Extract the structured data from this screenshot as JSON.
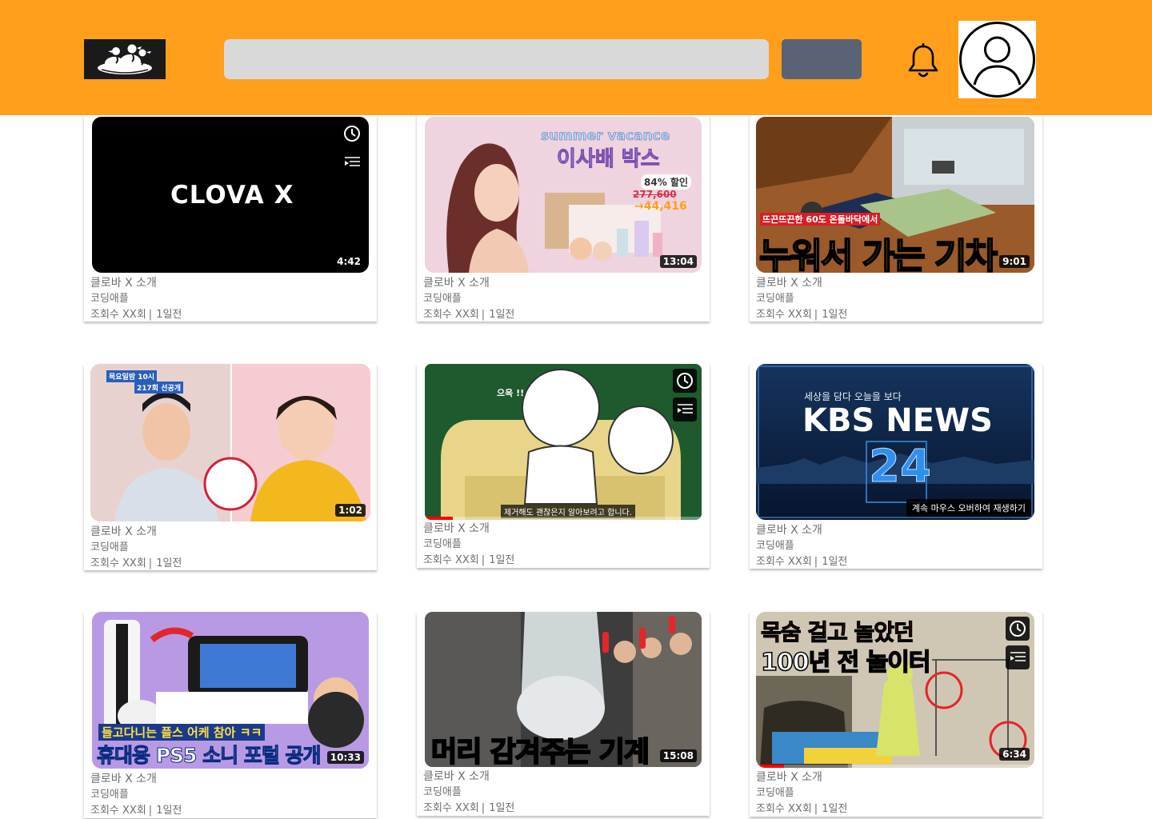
{
  "header": {
    "search_placeholder": "",
    "search_button_label": ""
  },
  "colors": {
    "header_bg": "#ff9f1c",
    "search_bg": "#d9d9d9",
    "search_button_bg": "#5a6276",
    "progress": "#ff0000"
  },
  "videos": [
    {
      "title": "클로바 X 소개",
      "channel": "코딩애플",
      "views": "조회수 XX회",
      "age": "1일전",
      "duration": "4:42",
      "thumb_text": "CLOVA X",
      "icons": [
        "watch-later-icon",
        "add-to-queue-icon"
      ]
    },
    {
      "title": "클로바 X 소개",
      "channel": "코딩애플",
      "views": "조회수 XX회",
      "age": "1일전",
      "duration": "13:04",
      "thumb_text": "summer vacance",
      "thumb_text2": "이사배 박스",
      "thumb_text3": "84% 할인",
      "thumb_text4": "277,600",
      "thumb_text5": "→44,416"
    },
    {
      "title": "클로바 X 소개",
      "channel": "코딩애플",
      "views": "조회수 XX회",
      "age": "1일전",
      "duration": "9:01",
      "thumb_text": "뜨끈뜨끈한 60도 온돌바닥에서",
      "thumb_text2": "누워서 가는 기차"
    },
    {
      "title": "클로바 X 소개",
      "channel": "코딩애플",
      "views": "조회수 XX회",
      "age": "1일전",
      "duration": "1:02",
      "thumb_text": "목요일밤 10시",
      "thumb_text2": "217회 선공개"
    },
    {
      "title": "클로바 X 소개",
      "channel": "코딩애플",
      "views": "조회수 XX회",
      "age": "1일전",
      "duration": "",
      "thumb_text": "으윽 !!",
      "thumb_text2": "제거해도 괜찮은지 알아보려고 합니다.",
      "icons": [
        "watch-later-icon",
        "add-to-queue-icon"
      ],
      "progress": 0.1
    },
    {
      "title": "클로바 X 소개",
      "channel": "코딩애플",
      "views": "조회수 XX회",
      "age": "1일전",
      "duration": "",
      "thumb_text": "세상을 담다 오늘을 보다",
      "thumb_text2": "KBS NEWS",
      "thumb_text3": "24",
      "hover_tip": "계속 마우스 오버하여 재생하기"
    },
    {
      "title": "클로바 X 소개",
      "channel": "코딩애플",
      "views": "조회수 XX회",
      "age": "1일전",
      "duration": "10:33",
      "thumb_text": "들고다니는 플스 어케 참아 ㅋㅋ",
      "thumb_text2": "휴대용 PS5 소니 포털 공개"
    },
    {
      "title": "클로바 X 소개",
      "channel": "코딩애플",
      "views": "조회수 XX회",
      "age": "1일전",
      "duration": "15:08",
      "thumb_text": "머리 감겨주는 기계"
    },
    {
      "title": "클로바 X 소개",
      "channel": "코딩애플",
      "views": "조회수 XX회",
      "age": "1일전",
      "duration": "6:34",
      "thumb_text": "목숨 걸고 놀았던",
      "thumb_text2": "100년 전 놀이터",
      "icons": [
        "watch-later-icon",
        "add-to-queue-icon"
      ],
      "progress": 0.1
    }
  ]
}
